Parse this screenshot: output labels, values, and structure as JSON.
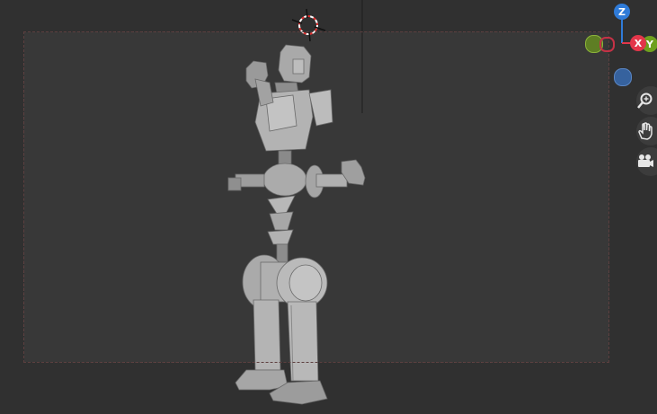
{
  "viewport": {
    "name": "3D viewport",
    "background": "#303030",
    "camera_frame_color": "#e8a0a0"
  },
  "gizmo": {
    "z_label": "Z",
    "x_label": "X",
    "y_label": "Y",
    "z_color": "#2f7bd8",
    "x_color": "#e3364a",
    "y_color": "#6fa01e",
    "neg_y_color": "#6a8a2a",
    "neg_z_color": "#36629e"
  },
  "navigation": {
    "zoom_icon": "zoom-magnifier-icon",
    "pan_icon": "hand-pan-icon",
    "camera_icon": "camera-view-icon"
  },
  "scene": {
    "object": "robot-model",
    "cursor": "3d-cursor"
  }
}
